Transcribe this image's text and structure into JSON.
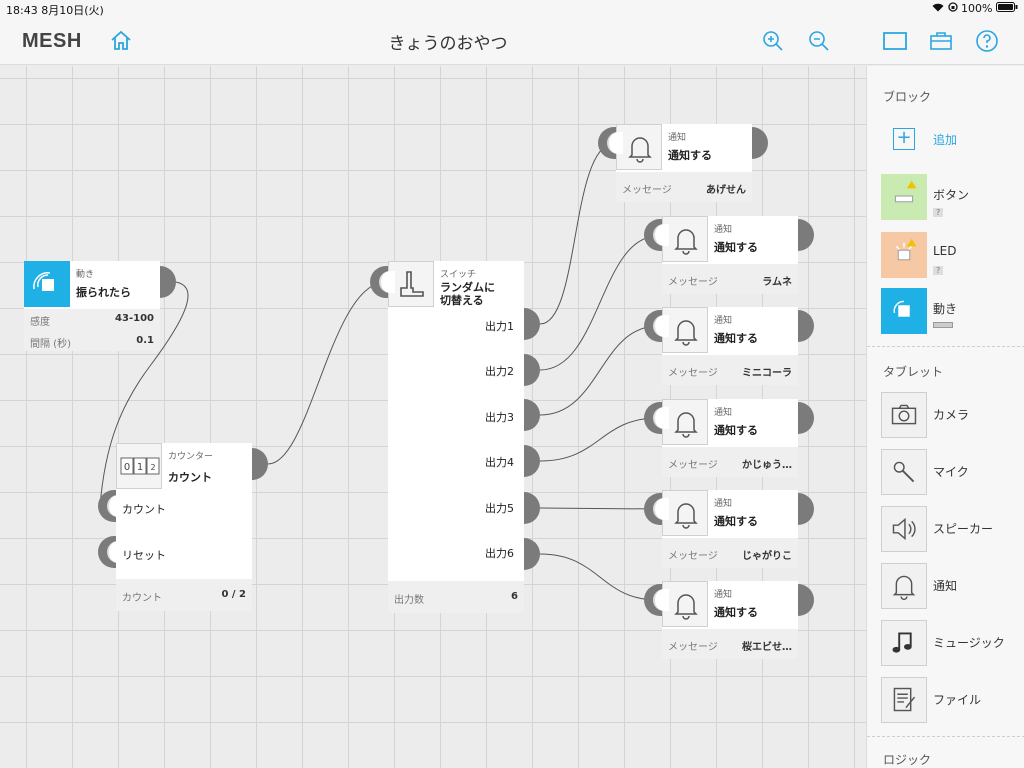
{
  "status": {
    "time_date": "18:43  8月10日(火)",
    "battery": "100%"
  },
  "toolbar": {
    "logo": "MESH",
    "title": "きょうのおやつ"
  },
  "blocks": {
    "move": {
      "category": "動き",
      "name": "振られたら",
      "props": [
        {
          "k": "感度",
          "v": "43-100"
        },
        {
          "k": "間隔 (秒)",
          "v": "0.1"
        }
      ]
    },
    "counter": {
      "category": "カウンター",
      "name": "カウント",
      "in1": "カウント",
      "in2": "リセット",
      "foot_k": "カウント",
      "foot_v": "0 / 2",
      "digits": "0 1"
    },
    "switch": {
      "category": "スイッチ",
      "name_l1": "ランダムに",
      "name_l2": "切替える",
      "outputs": [
        "出力1",
        "出力2",
        "出力3",
        "出力4",
        "出力5",
        "出力6"
      ],
      "foot_k": "出力数",
      "foot_v": "6"
    },
    "notifs": [
      {
        "category": "通知",
        "name": "通知する",
        "msg_k": "メッセージ",
        "msg_v": "あげせん"
      },
      {
        "category": "通知",
        "name": "通知する",
        "msg_k": "メッセージ",
        "msg_v": "ラムネ"
      },
      {
        "category": "通知",
        "name": "通知する",
        "msg_k": "メッセージ",
        "msg_v": "ミニコーラ"
      },
      {
        "category": "通知",
        "name": "通知する",
        "msg_k": "メッセージ",
        "msg_v": "かじゅう…"
      },
      {
        "category": "通知",
        "name": "通知する",
        "msg_k": "メッセージ",
        "msg_v": "じゃがりこ"
      },
      {
        "category": "通知",
        "name": "通知する",
        "msg_k": "メッセージ",
        "msg_v": "桜エビせ…"
      }
    ]
  },
  "sidebar": {
    "section_blocks": "ブロック",
    "add": "追加",
    "mesh_items": [
      {
        "label": "ボタン",
        "badge": "?"
      },
      {
        "label": "LED",
        "badge": "?"
      },
      {
        "label": "動き"
      }
    ],
    "section_tablet": "タブレット",
    "tablet_items": [
      {
        "label": "カメラ"
      },
      {
        "label": "マイク"
      },
      {
        "label": "スピーカー"
      },
      {
        "label": "通知"
      },
      {
        "label": "ミュージック"
      },
      {
        "label": "ファイル"
      }
    ],
    "section_logic": "ロジック"
  },
  "colors": {
    "accent": "#2ba6e0",
    "move_tile": "#1fb0e6",
    "button_tile": "#c9eab0",
    "led_tile": "#f6c9a4",
    "port": "#7b7b7b"
  }
}
